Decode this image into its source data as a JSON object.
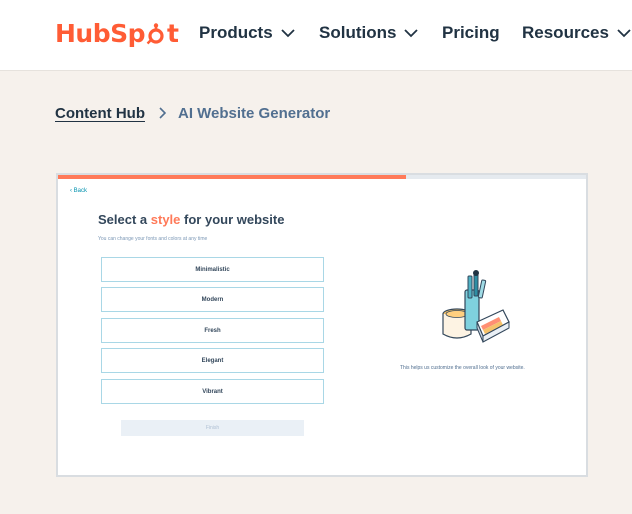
{
  "header": {
    "logo_text_left": "HubSp",
    "logo_text_right": "t",
    "nav": [
      {
        "label": "Products",
        "has_dropdown": true
      },
      {
        "label": "Solutions",
        "has_dropdown": true
      },
      {
        "label": "Pricing",
        "has_dropdown": false
      },
      {
        "label": "Resources",
        "has_dropdown": true
      }
    ]
  },
  "breadcrumb": {
    "parent": "Content Hub",
    "current": "AI Website Generator"
  },
  "preview": {
    "progress_percent": 66,
    "back_label": "‹ Back",
    "title_prefix": "Select a ",
    "title_accent": "style",
    "title_suffix": " for your website",
    "subtitle": "You can change your fonts and colors at any time",
    "options": [
      "Minimalistic",
      "Modern",
      "Fresh",
      "Elegant",
      "Vibrant"
    ],
    "finish_label": "Finish",
    "helper_text": "This helps us customize the overall look of your website."
  },
  "colors": {
    "brand_orange": "#ff5c35",
    "accent_orange": "#ff7a59",
    "header_bg": "#ffffff",
    "page_bg": "#f6f1ec",
    "option_border": "#a9d7e6"
  }
}
